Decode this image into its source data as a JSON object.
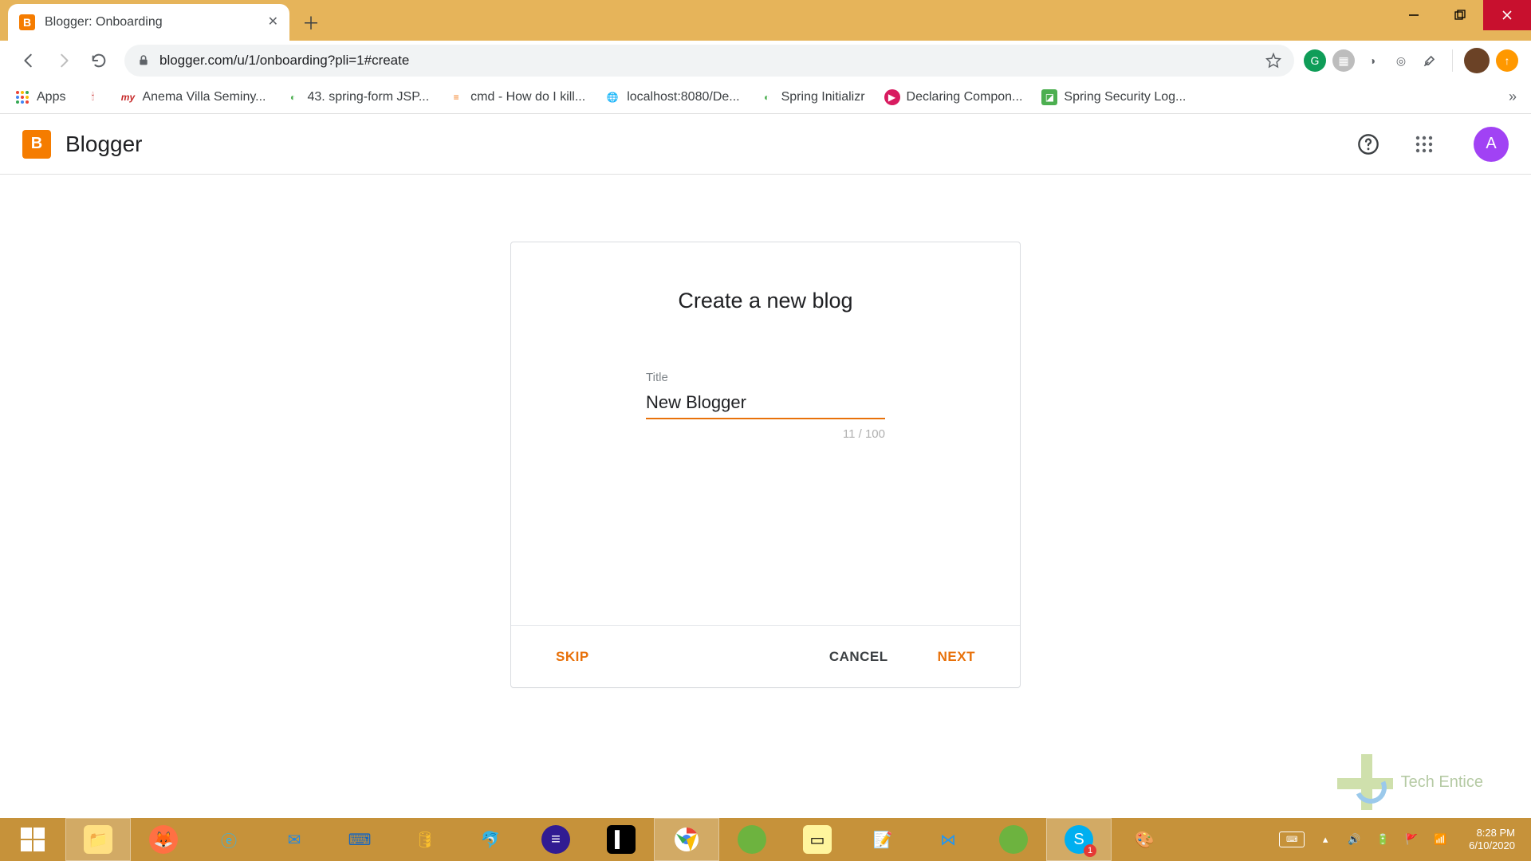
{
  "window": {
    "tab_title": "Blogger: Onboarding",
    "url": "blogger.com/u/1/onboarding?pli=1#create"
  },
  "bookmarks": {
    "apps": "Apps",
    "items": [
      {
        "label": "Anema Villa Seminy...",
        "color": "#c62828",
        "glyph": "my"
      },
      {
        "label": "43. spring-form JSP...",
        "color": "#4caf50",
        "glyph": "◐"
      },
      {
        "label": "cmd - How do I kill...",
        "color": "#f48024",
        "glyph": "≡"
      },
      {
        "label": "localhost:8080/De...",
        "color": "#616161",
        "glyph": "🌐"
      },
      {
        "label": "Spring Initializr",
        "color": "#4caf50",
        "glyph": "◐"
      },
      {
        "label": "Declaring Compon...",
        "color": "#d81b60",
        "glyph": "▶"
      },
      {
        "label": "Spring Security Log...",
        "color": "#4caf50",
        "glyph": "◪"
      }
    ],
    "extra_icon": "🕯"
  },
  "bloggerHeader": {
    "app_name": "Blogger",
    "avatar_letter": "A"
  },
  "modal": {
    "title": "Create a new blog",
    "field_label": "Title",
    "field_value": "New Blogger",
    "char_count": "11 / 100",
    "skip": "SKIP",
    "cancel": "CANCEL",
    "next": "NEXT"
  },
  "watermark": {
    "text": "Tech Entice"
  },
  "systray": {
    "time": "8:28 PM",
    "date": "6/10/2020"
  }
}
